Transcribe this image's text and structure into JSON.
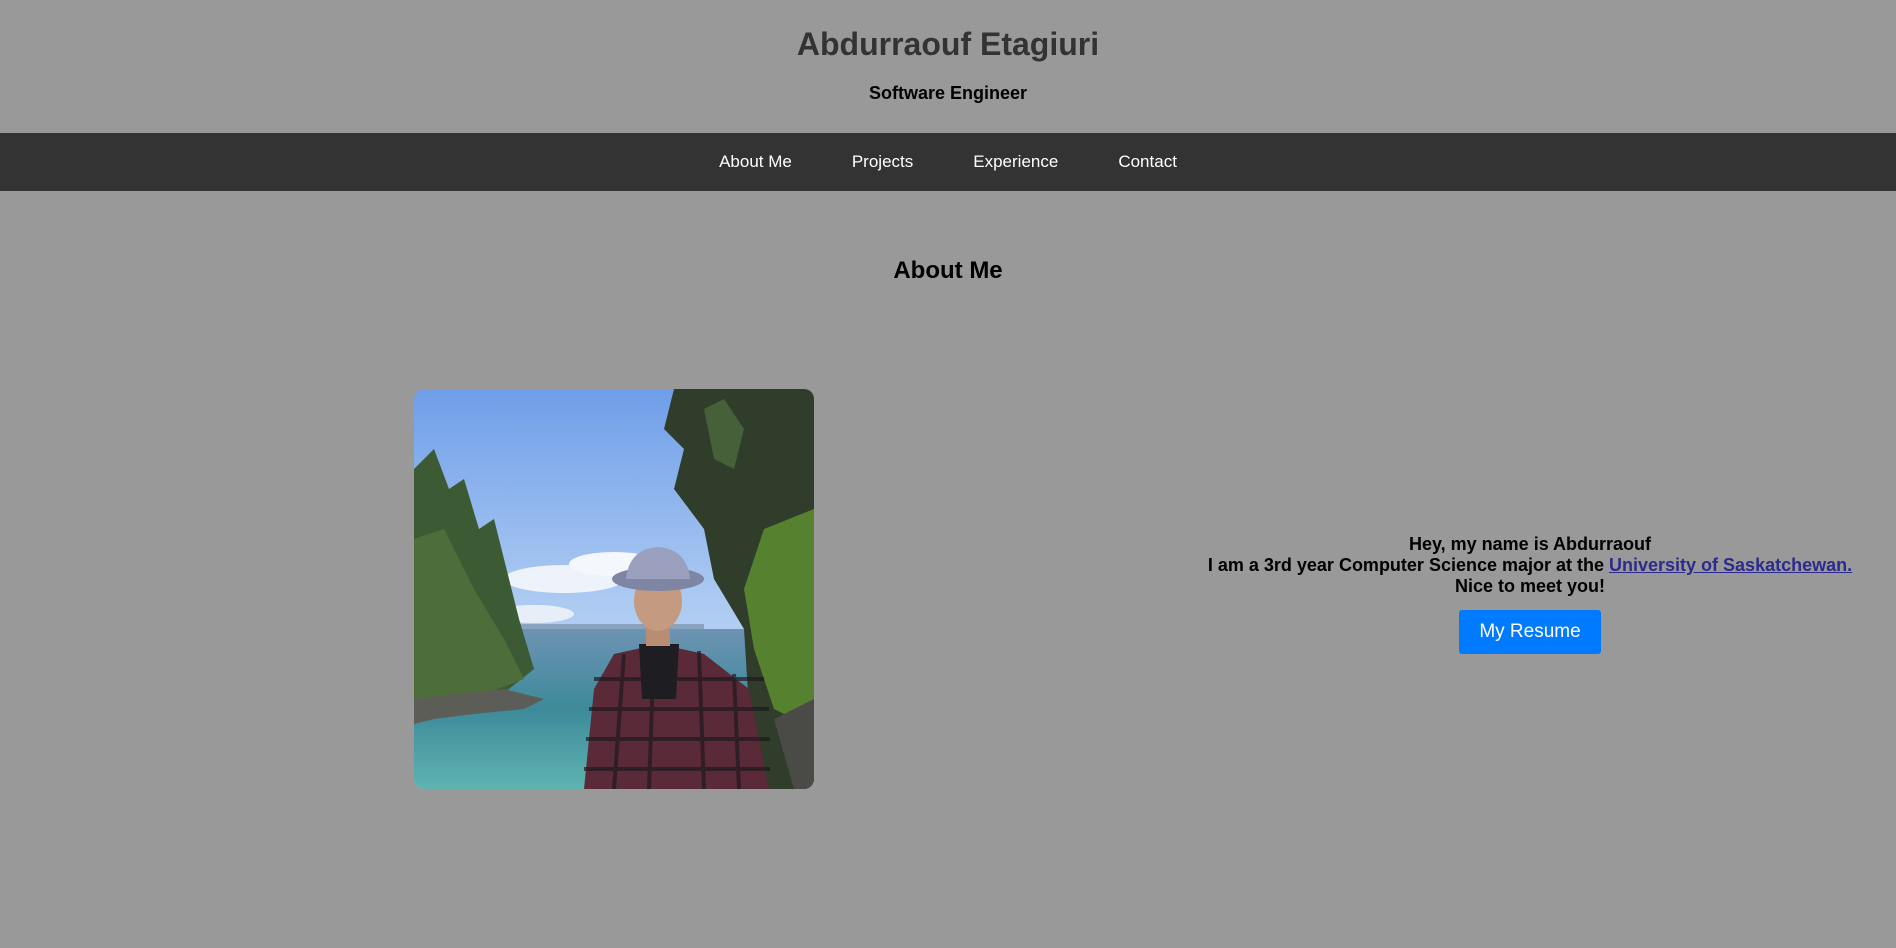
{
  "header": {
    "name": "Abdurraouf Etagiuri",
    "role": "Software Engineer"
  },
  "nav": {
    "items": [
      {
        "label": "About Me"
      },
      {
        "label": "Projects"
      },
      {
        "label": "Experience"
      },
      {
        "label": "Contact"
      }
    ]
  },
  "about": {
    "title": "About Me",
    "greeting": "Hey, my name is Abdurraouf",
    "line_prefix": "I am a 3rd year Computer Science major at the ",
    "university_link": "University of Saskatchewan.",
    "closing": "Nice to meet you!",
    "resume_button": "My Resume"
  },
  "colors": {
    "background": "#999999",
    "navbar": "#333333",
    "button": "#007bff",
    "link": "#2b2b8f"
  }
}
